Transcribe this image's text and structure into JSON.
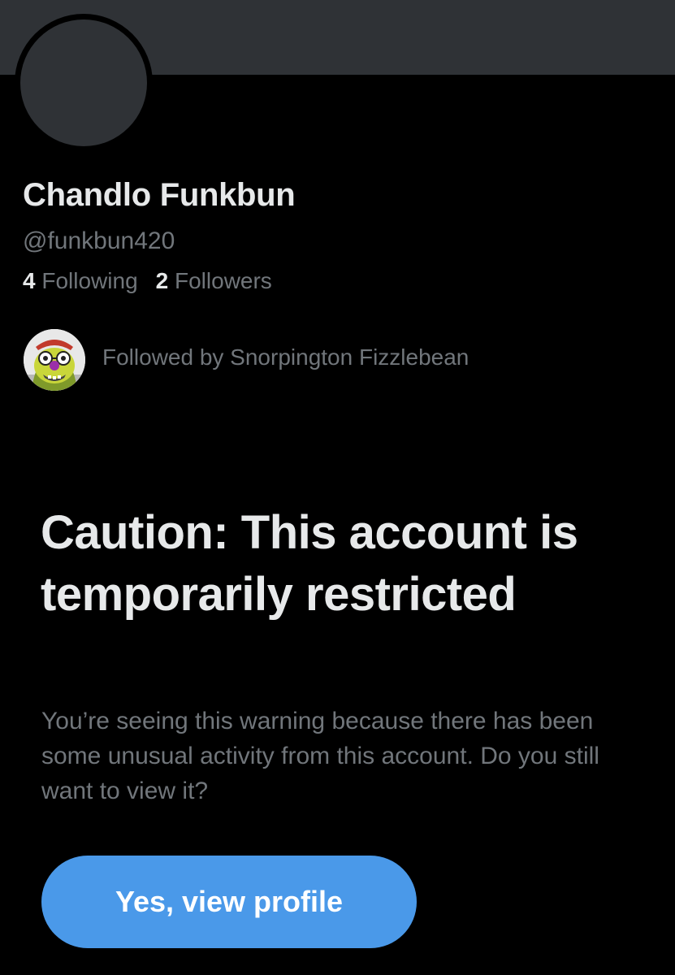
{
  "profile": {
    "display_name": "Chandlo Funkbun",
    "handle": "@funkbun420",
    "following_count": "4",
    "following_label": "Following",
    "followers_count": "2",
    "followers_label": "Followers",
    "avatar_placeholder_color": "#2f3236",
    "banner_color": "#2f3236"
  },
  "followed_by": {
    "text": "Followed by Snorpington Fizzlebean",
    "avatar_icon": "cartoon-character-avatar"
  },
  "warning": {
    "title": "Caution: This account is temporarily restricted",
    "body": "You’re seeing this warning because there has been some unusual activity from this account. Do you still want to view it?",
    "button_label": "Yes, view profile",
    "button_color": "#4a99e9"
  }
}
